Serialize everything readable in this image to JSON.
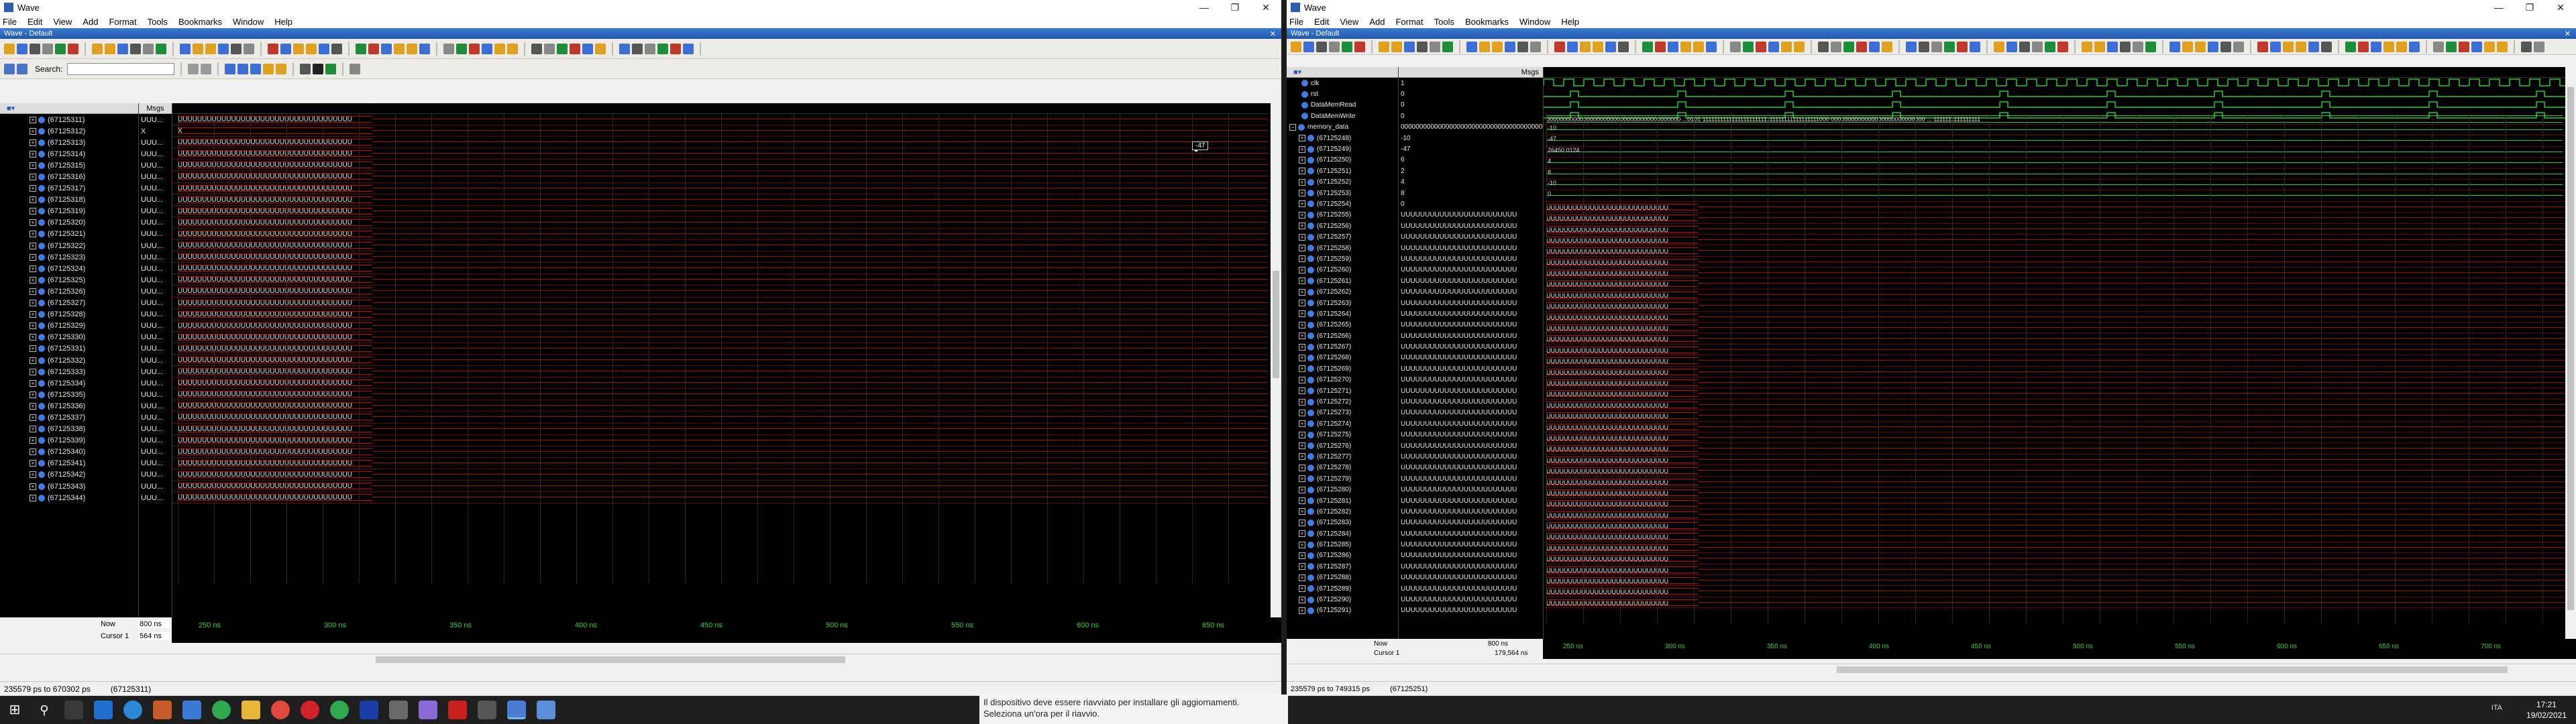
{
  "left": {
    "title": "Wave",
    "menu": [
      "File",
      "Edit",
      "View",
      "Add",
      "Format",
      "Tools",
      "Bookmarks",
      "Window",
      "Help"
    ],
    "subtitle": "Wave - Default",
    "search_label": "Search:",
    "name_header": "",
    "value_header": "Msgs",
    "signals": [
      "(67125311)",
      "(67125312)",
      "(67125313)",
      "(67125314)",
      "(67125315)",
      "(67125316)",
      "(67125317)",
      "(67125318)",
      "(67125319)",
      "(67125320)",
      "(67125321)",
      "(67125322)",
      "(67125323)",
      "(67125324)",
      "(67125325)",
      "(67125326)",
      "(67125327)",
      "(67125328)",
      "(67125329)",
      "(67125330)",
      "(67125331)",
      "(67125332)",
      "(67125333)",
      "(67125334)",
      "(67125335)",
      "(67125336)",
      "(67125337)",
      "(67125338)",
      "(67125339)",
      "(67125340)",
      "(67125341)",
      "(67125342)",
      "(67125343)",
      "(67125344)"
    ],
    "values": [
      "UUU...",
      "X",
      "UUU...",
      "UUU...",
      "UUU...",
      "UUU...",
      "UUU...",
      "UUU...",
      "UUU...",
      "UUU...",
      "UUU...",
      "UUU...",
      "UUU...",
      "UUU...",
      "UUU...",
      "UUU...",
      "UUU...",
      "UUU...",
      "UUU...",
      "UUU...",
      "UUU...",
      "UUU...",
      "UUU...",
      "UUU...",
      "UUU...",
      "UUU...",
      "UUU...",
      "UUU...",
      "UUU...",
      "UUU...",
      "UUU...",
      "UUU...",
      "UUU...",
      "UUU..."
    ],
    "wave_text": "UUUUUUUUUUUUUUUUUUUUUUUUUUUUUUUUUUUU",
    "wave_x_text": "X",
    "marker_value": "-47",
    "now_label": "Now",
    "now_value": "800 ns",
    "cursor_label": "Cursor 1",
    "cursor_value": "564 ns",
    "time_ticks": [
      "250 ns",
      "300 ns",
      "350 ns",
      "400 ns",
      "450 ns",
      "500 ns",
      "550 ns",
      "600 ns",
      "650 ns"
    ],
    "status_range": "235579 ps to 670302 ps",
    "status_sel": "(67125311)"
  },
  "right": {
    "title": "Wave",
    "menu": [
      "File",
      "Edit",
      "View",
      "Add",
      "Format",
      "Tools",
      "Bookmarks",
      "Window",
      "Help"
    ],
    "subtitle": "Wave - Default",
    "search_label": "Search:",
    "value_header": "Msgs",
    "top_signals": [
      {
        "name": "clk",
        "value": "1"
      },
      {
        "name": "rst",
        "value": "0"
      },
      {
        "name": "DataMemRead",
        "value": "0"
      },
      {
        "name": "DataMemWrite",
        "value": "0"
      },
      {
        "name": "memory_data",
        "value": "0000000000000000000000000000000000000000000..."
      }
    ],
    "mem_signals": [
      "(67125248)",
      "(67125249)",
      "(67125250)",
      "(67125251)",
      "(67125252)",
      "(67125253)",
      "(67125254)",
      "(67125255)",
      "(67125256)",
      "(67125257)",
      "(67125258)",
      "(67125259)",
      "(67125260)",
      "(67125261)",
      "(67125262)",
      "(67125263)",
      "(67125264)",
      "(67125265)",
      "(67125266)",
      "(67125267)",
      "(67125268)",
      "(67125269)",
      "(67125270)",
      "(67125271)",
      "(67125272)",
      "(67125273)",
      "(67125274)",
      "(67125275)",
      "(67125276)",
      "(67125277)",
      "(67125278)",
      "(67125279)",
      "(67125280)",
      "(67125281)",
      "(67125282)",
      "(67125283)",
      "(67125284)",
      "(67125285)",
      "(67125286)",
      "(67125287)",
      "(67125288)",
      "(67125289)",
      "(67125290)",
      "(67125291)"
    ],
    "mem_values": [
      "-10",
      "-47",
      "6",
      "2",
      "4",
      "8",
      "0",
      "UUUUUUUUUUUUUUUUUUUUUUUU",
      "UUUUUUUUUUUUUUUUUUUUUUUU",
      "UUUUUUUUUUUUUUUUUUUUUUUU",
      "UUUUUUUUUUUUUUUUUUUUUUUU",
      "UUUUUUUUUUUUUUUUUUUUUUUU",
      "UUUUUUUUUUUUUUUUUUUUUUUU",
      "UUUUUUUUUUUUUUUUUUUUUUUU",
      "UUUUUUUUUUUUUUUUUUUUUUUU",
      "UUUUUUUUUUUUUUUUUUUUUUUU",
      "UUUUUUUUUUUUUUUUUUUUUUUU",
      "UUUUUUUUUUUUUUUUUUUUUUUU",
      "UUUUUUUUUUUUUUUUUUUUUUUU",
      "UUUUUUUUUUUUUUUUUUUUUUUU",
      "UUUUUUUUUUUUUUUUUUUUUUUU",
      "UUUUUUUUUUUUUUUUUUUUUUUU",
      "UUUUUUUUUUUUUUUUUUUUUUUU",
      "UUUUUUUUUUUUUUUUUUUUUUUU",
      "UUUUUUUUUUUUUUUUUUUUUUUU",
      "UUUUUUUUUUUUUUUUUUUUUUUU",
      "UUUUUUUUUUUUUUUUUUUUUUUU",
      "UUUUUUUUUUUUUUUUUUUUUUUU",
      "UUUUUUUUUUUUUUUUUUUUUUUU",
      "UUUUUUUUUUUUUUUUUUUUUUUU",
      "UUUUUUUUUUUUUUUUUUUUUUUU",
      "UUUUUUUUUUUUUUUUUUUUUUUU",
      "UUUUUUUUUUUUUUUUUUUUUUUU",
      "UUUUUUUUUUUUUUUUUUUUUUUU",
      "UUUUUUUUUUUUUUUUUUUUUUUU",
      "UUUUUUUUUUUUUUUUUUUUUUUU",
      "UUUUUUUUUUUUUUUUUUUUUUUU",
      "UUUUUUUUUUUUUUUUUUUUUUUU",
      "UUUUUUUUUUUUUUUUUUUUUUUU",
      "UUUUUUUUUUUUUUUUUUUUUUUU",
      "UUUUUUUUUUUUUUUUUUUUUUUU",
      "UUUUUUUUUUUUUUUUUUUUUUUU",
      "UUUUUUUUUUUUUUUUUUUUUUUU",
      "UUUUUUUUUUUUUUUUUUUUUUUU",
      "UUUUUUUUUUUUUUUUUUUUUUUU"
    ],
    "wave_small_labels": [
      "-10",
      "-47",
      "26450 0124",
      "4",
      "8",
      "-10",
      "0"
    ],
    "wave_text": "UUUUUUUUUUUUUUUUUUUUUUUUUUUU",
    "memory_wave_text": "0000000000000000000000000000000000000000 ...0101 1111111111111111111111111111111111111111000 0000000000000000000000000000 ... 1111111111111111",
    "now_label": "Now",
    "now_value": "800 ns",
    "cursor_label": "Cursor 1",
    "cursor_value": "179,564 ns",
    "time_ticks": [
      "250 ns",
      "300 ns",
      "350 ns",
      "400 ns",
      "450 ns",
      "500 ns",
      "550 ns",
      "600 ns",
      "650 ns",
      "700 ns"
    ],
    "status_range": "235579 ps to 749315 ps",
    "status_sel": "(67125251)"
  },
  "toast": {
    "line1": "Il dispositivo deve essere riavviato per installare gli aggiornamenti.",
    "line2": "Seleziona un'ora per il riavvio."
  },
  "clock": {
    "time": "17:21",
    "date": "19/02/2021"
  },
  "tray": "ITA"
}
